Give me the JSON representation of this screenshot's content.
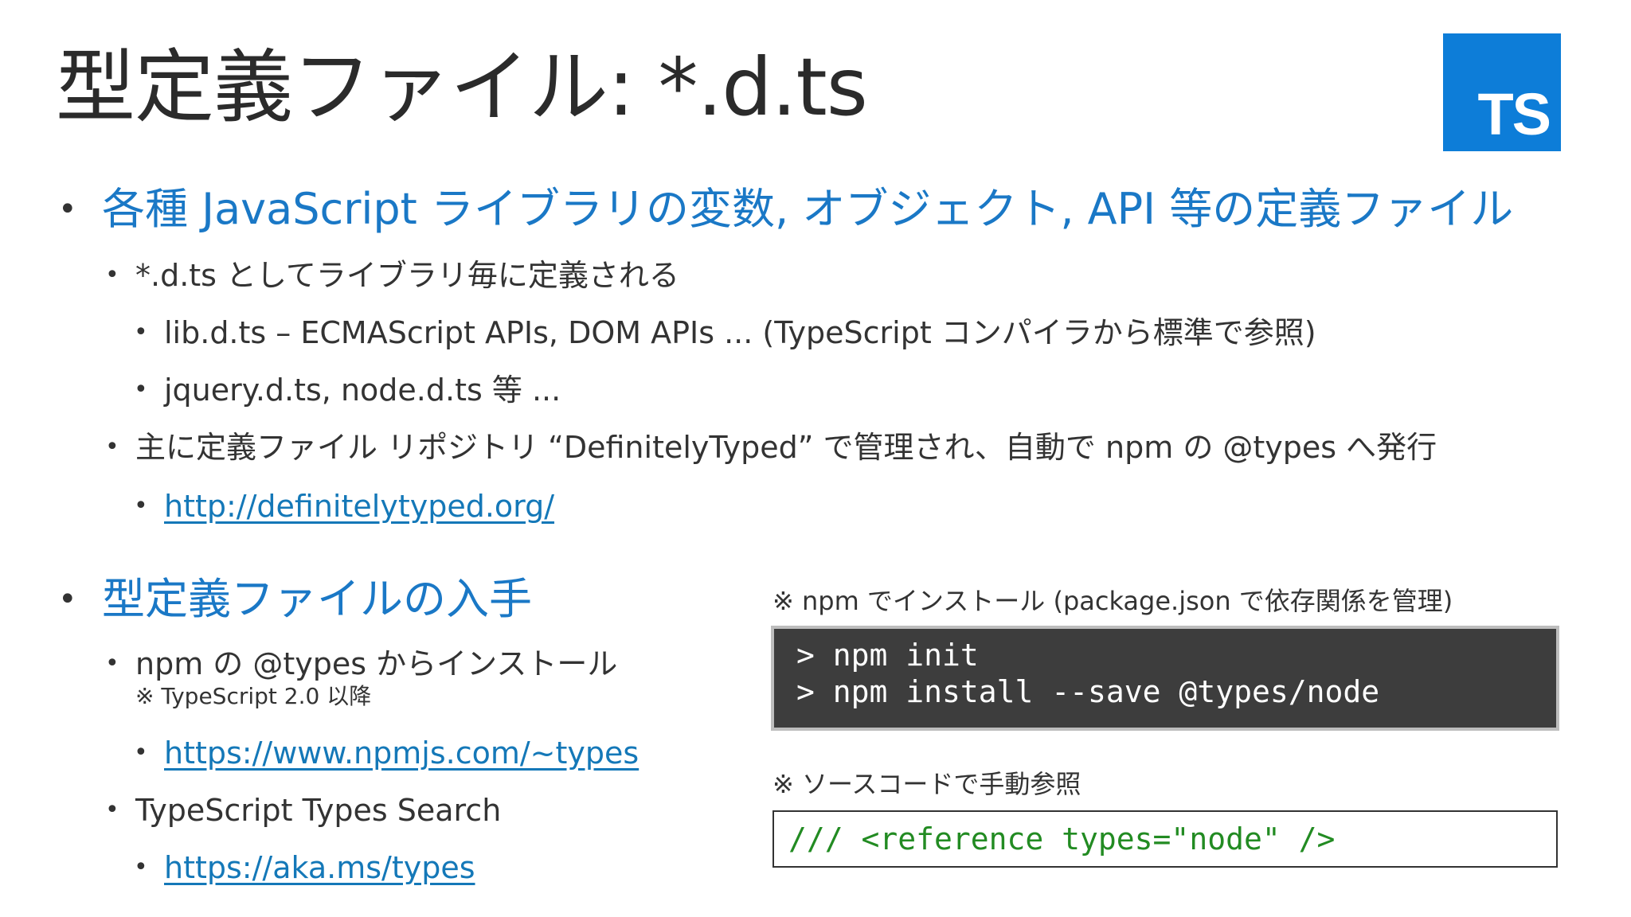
{
  "title": "型定義ファイル: *.d.ts",
  "logo": {
    "text": "TS",
    "bg": "#0d7dd8"
  },
  "section1": {
    "heading": "各種 JavaScript ライブラリの変数, オブジェクト, API 等の定義ファイル",
    "items": [
      "*.d.ts としてライブラリ毎に定義される",
      "lib.d.ts – ECMAScript APIs, DOM APIs ... (TypeScript コンパイラから標準で参照)",
      "jquery.d.ts, node.d.ts 等 ...",
      "主に定義ファイル リポジトリ “DefinitelyTyped” で管理され、自動で npm の @types へ発行",
      "http://definitelytyped.org/"
    ]
  },
  "section2": {
    "heading": "型定義ファイルの入手",
    "npm_item": "npm の @types からインストール",
    "npm_note": "※ TypeScript 2.0 以降",
    "npm_link": "https://www.npmjs.com/~types",
    "search_item": "TypeScript Types Search",
    "search_link": "https://aka.ms/types"
  },
  "install_note": "※ npm でインストール (package.json で依存関係を管理)",
  "install_code": [
    "> npm init",
    "> npm install --save @types/node"
  ],
  "manual_note": "※ ソースコードで手動参照",
  "manual_code": "/// <reference types=\"node\" />",
  "colors": {
    "heading": "#1a78c6",
    "link": "#1478b8",
    "code_bg": "#3d3d3d",
    "code_green": "#228b22"
  }
}
